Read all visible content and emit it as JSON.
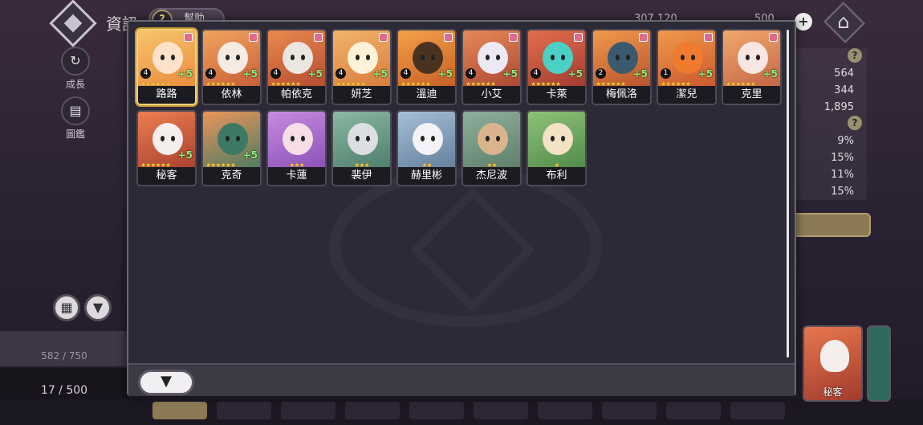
{
  "background": {
    "title": "資訊",
    "help_label": "幫助",
    "help_glyph": "?",
    "side_buttons": [
      {
        "label": "成長",
        "icon": "growth-icon",
        "glyph": "↻"
      },
      {
        "label": "圖鑑",
        "icon": "book-icon",
        "glyph": "▤"
      }
    ],
    "currency_1": "307,120",
    "currency_2": "500",
    "stats": [
      "564",
      "344",
      "1,895",
      "9%",
      "15%",
      "11%",
      "15%"
    ],
    "count_a": "582 / 750",
    "count_b": "17 / 500",
    "right_card_name": "秘客"
  },
  "modal": {
    "filter_glyph": "▼",
    "cards": [
      {
        "name": "路路",
        "level": "4",
        "plus": "+5",
        "stars": 6,
        "color_top": "#f7c46a",
        "color_bot": "#e98a3d",
        "face": "#ffe2c9",
        "selected": true
      },
      {
        "name": "依林",
        "level": "4",
        "plus": "+5",
        "stars": 6,
        "color_top": "#f0a45f",
        "color_bot": "#c75b36",
        "face": "#f6ebe2",
        "selected": false
      },
      {
        "name": "帕依克",
        "level": "4",
        "plus": "+5",
        "stars": 6,
        "color_top": "#e9894e",
        "color_bot": "#b34a2f",
        "face": "#ece6e0",
        "selected": false
      },
      {
        "name": "妍芝",
        "level": "4",
        "plus": "+5",
        "stars": 6,
        "color_top": "#f3b46a",
        "color_bot": "#d67a3a",
        "face": "#fff2d8",
        "selected": false
      },
      {
        "name": "溫迪",
        "level": "4",
        "plus": "+5",
        "stars": 6,
        "color_top": "#f3a048",
        "color_bot": "#c55d25",
        "face": "#4a3220",
        "selected": false
      },
      {
        "name": "小艾",
        "level": "4",
        "plus": "+5",
        "stars": 6,
        "color_top": "#e78857",
        "color_bot": "#a84532",
        "face": "#ece9f4",
        "selected": false
      },
      {
        "name": "卡萊",
        "level": "4",
        "plus": "+5",
        "stars": 6,
        "color_top": "#e36e4d",
        "color_bot": "#9f3a31",
        "face": "#4ad0c4",
        "selected": false
      },
      {
        "name": "梅佩洛",
        "level": "2",
        "plus": "+5",
        "stars": 6,
        "color_top": "#f09a4c",
        "color_bot": "#b7502c",
        "face": "#3b5a6e",
        "selected": false
      },
      {
        "name": "潔兒",
        "level": "1",
        "plus": "+5",
        "stars": 6,
        "color_top": "#f19a4c",
        "color_bot": "#c8552c",
        "face": "#f07a2e",
        "selected": false
      },
      {
        "name": "克里",
        "level": "",
        "plus": "+5",
        "stars": 6,
        "color_top": "#f2a86d",
        "color_bot": "#c26343",
        "face": "#f7e6e1",
        "selected": false
      },
      {
        "name": "秘客",
        "level": "",
        "plus": "+5",
        "stars": 6,
        "color_top": "#ec7e4f",
        "color_bot": "#a73f30",
        "face": "#f4eeec",
        "selected": false
      },
      {
        "name": "克奇",
        "level": "",
        "plus": "+5",
        "stars": 6,
        "color_top": "#e9955a",
        "color_bot": "#4a7a62",
        "face": "#3e7a63",
        "selected": false
      },
      {
        "name": "卡蓮",
        "level": "",
        "plus": "",
        "stars": 3,
        "color_top": "#c88be0",
        "color_bot": "#8a4fb6",
        "face": "#f6dde6",
        "selected": false
      },
      {
        "name": "裴伊",
        "level": "",
        "plus": "",
        "stars": 3,
        "color_top": "#8ab8a4",
        "color_bot": "#4c7c6a",
        "face": "#dcdfe2",
        "selected": false
      },
      {
        "name": "赫里彬",
        "level": "",
        "plus": "",
        "stars": 2,
        "color_top": "#a6bfd6",
        "color_bot": "#627e9c",
        "face": "#f3f3f5",
        "selected": false
      },
      {
        "name": "杰尼波",
        "level": "",
        "plus": "",
        "stars": 2,
        "color_top": "#8fb09a",
        "color_bot": "#5c7d69",
        "face": "#d9b48c",
        "selected": false
      },
      {
        "name": "布利",
        "level": "",
        "plus": "",
        "stars": 1,
        "color_top": "#8ec27a",
        "color_bot": "#4f8a46",
        "face": "#f3e2c3",
        "selected": false
      }
    ]
  }
}
